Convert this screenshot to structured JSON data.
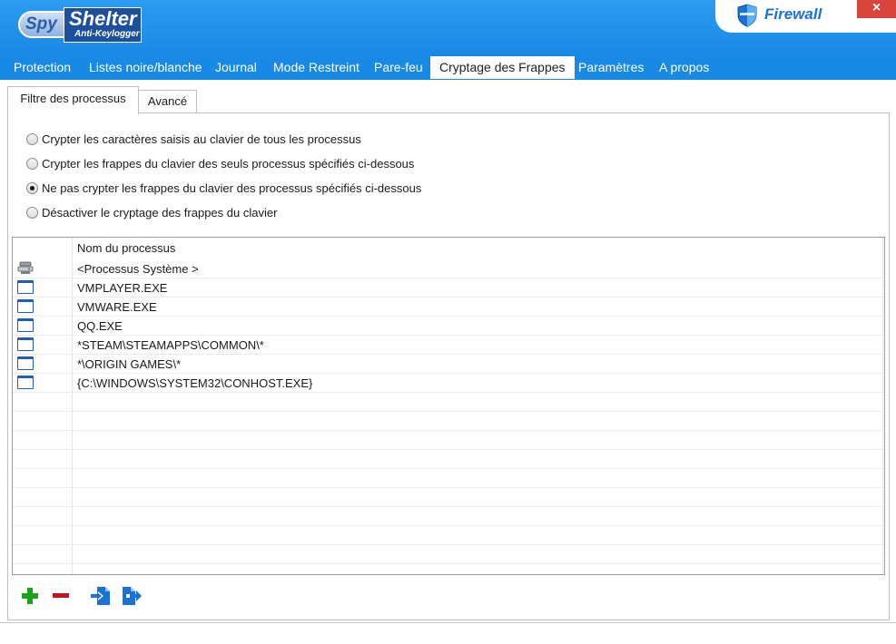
{
  "app": {
    "logo_spy": "Spy",
    "logo_shelter": "Shelter",
    "logo_sub": "Anti-Keylogger",
    "firewall_label": "Firewall",
    "close_symbol": "×"
  },
  "menu": {
    "items": [
      {
        "label": "Protection"
      },
      {
        "label": "Listes noire/blanche"
      },
      {
        "label": "Journal"
      },
      {
        "label": "Mode Restreint"
      },
      {
        "label": "Pare-feu"
      },
      {
        "label": "Cryptage des Frappes",
        "active": true
      },
      {
        "label": "Paramètres"
      },
      {
        "label": "A propos"
      }
    ]
  },
  "subtabs": {
    "active": "Filtre des processus",
    "inactive": "Avancé"
  },
  "options": [
    {
      "label": "Crypter les caractères saisis au clavier de tous les processus",
      "checked": false
    },
    {
      "label": "Crypter les frappes du clavier des seuls processus spécifiés ci-dessous",
      "checked": false
    },
    {
      "label": "Ne pas crypter les frappes du clavier des processus spécifiés ci-dessous",
      "checked": true
    },
    {
      "label": "Désactiver le cryptage des frappes du clavier",
      "checked": false
    }
  ],
  "process_list": {
    "header": "Nom du processus",
    "rows": [
      {
        "name": "<Processus Système >",
        "icon": "system-process-icon"
      },
      {
        "name": "VMPLAYER.EXE",
        "icon": "window-icon"
      },
      {
        "name": "VMWARE.EXE",
        "icon": "window-icon"
      },
      {
        "name": "QQ.EXE",
        "icon": "window-icon"
      },
      {
        "name": "*STEAM\\STEAMAPPS\\COMMON\\*",
        "icon": "window-icon"
      },
      {
        "name": "*\\ORIGIN GAMES\\*",
        "icon": "window-icon"
      },
      {
        "name": "{C:\\WINDOWS\\SYSTEM32\\CONHOST.EXE}",
        "icon": "window-icon"
      }
    ]
  },
  "toolbar": {
    "add_icon": "plus-icon",
    "remove_icon": "minus-icon",
    "import_icon": "import-icon",
    "export_icon": "export-icon"
  },
  "colors": {
    "accent": "#1989e6",
    "firewall_text": "#1a72d9",
    "close_red": "#d9443c",
    "add_green": "#1aa31a",
    "remove_red": "#c0171d"
  }
}
